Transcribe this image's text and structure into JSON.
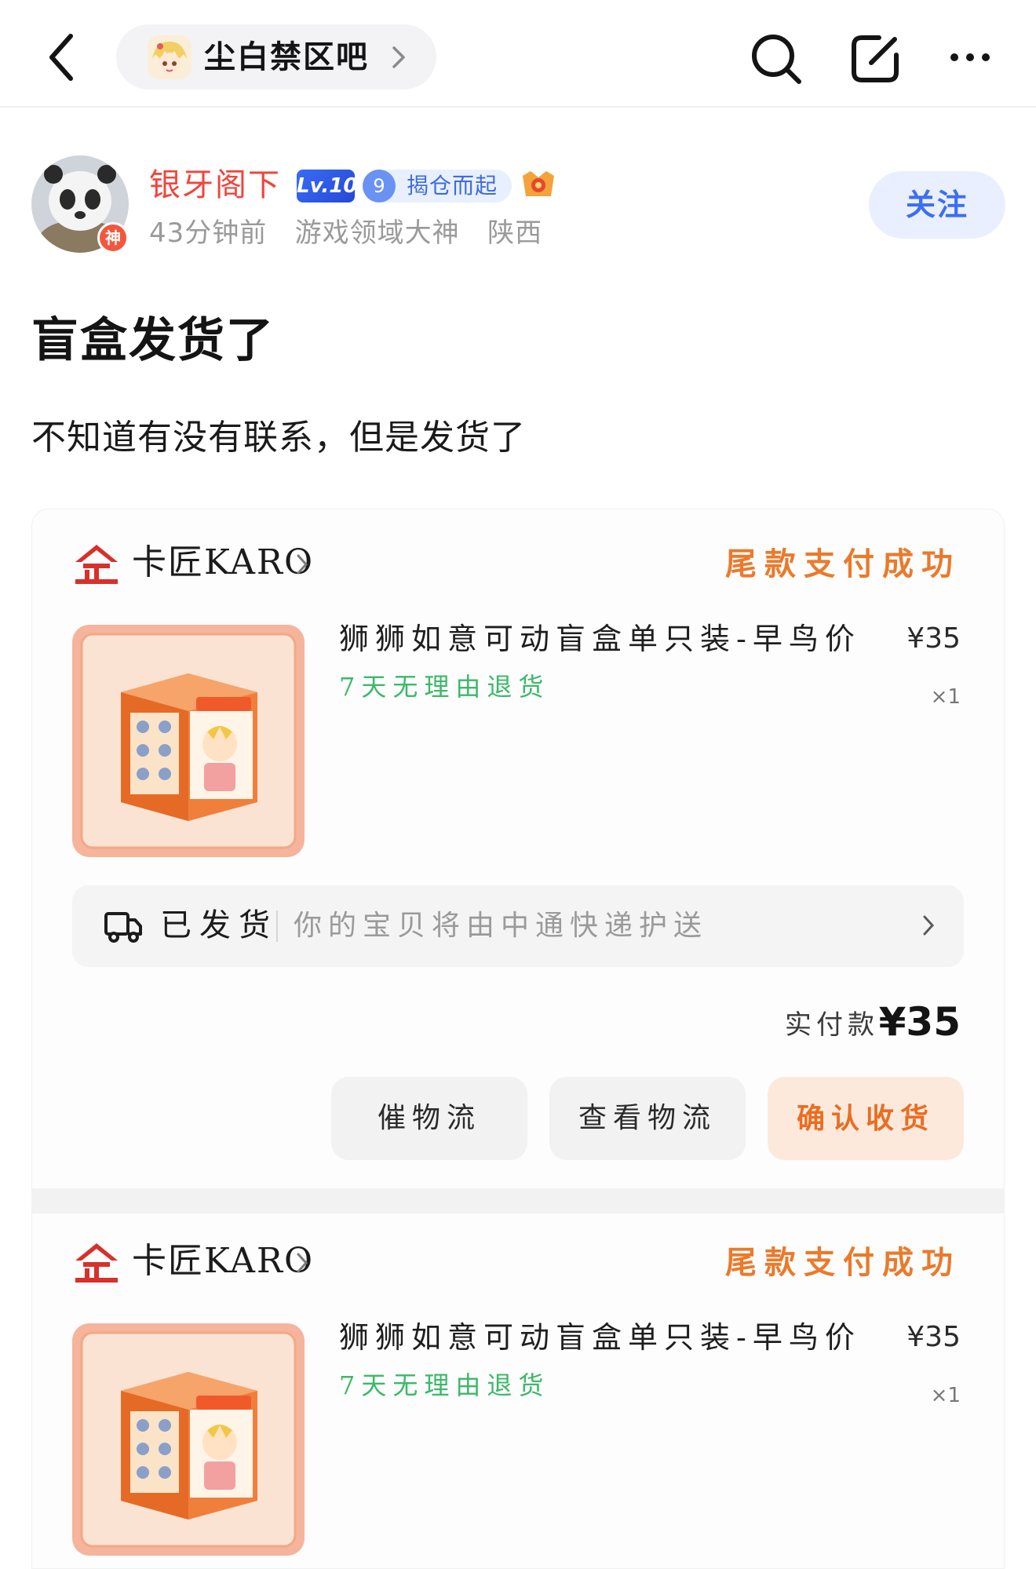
{
  "topbar": {
    "forum_name": "尘白禁区吧",
    "icons": [
      "back-icon",
      "search-icon",
      "edit-icon",
      "more-icon"
    ]
  },
  "author": {
    "name": "银牙阁下",
    "level": "Lv.10",
    "member_level": "9",
    "member_title": "揭仓而起",
    "god_badge": "神",
    "meta": "43分钟前   游戏领域大神   陕西",
    "follow_label": "关注"
  },
  "post": {
    "title": "盲盒发货了",
    "body": "不知道有没有联系，但是发货了"
  },
  "orders": [
    {
      "shop_name": "卡匠KARO",
      "status": "尾款支付成功",
      "product_title": "狮狮如意可动盲盒单只装-早鸟价",
      "return_tag": "7天无理由退货",
      "price": "¥35",
      "qty": "×1",
      "ship_status": "已发货",
      "ship_desc": "你的宝贝将由中通快递护送",
      "paid_label": "实付款",
      "paid_amount": "¥35",
      "buttons": [
        "催物流",
        "查看物流",
        "确认收货"
      ]
    },
    {
      "shop_name": "卡匠KARO",
      "status": "尾款支付成功",
      "product_title": "狮狮如意可动盲盒单只装-早鸟价",
      "return_tag": "7天无理由退货",
      "price": "¥35",
      "qty": "×1"
    }
  ],
  "colors": {
    "author_name": "#f0453c",
    "follow_text": "#3c6ef0",
    "follow_bg": "#e9efff",
    "pay_status": "#ea7a2c",
    "return_tag": "#3db86a",
    "confirm_text": "#e96d22",
    "confirm_bg": "#fde9dc"
  }
}
